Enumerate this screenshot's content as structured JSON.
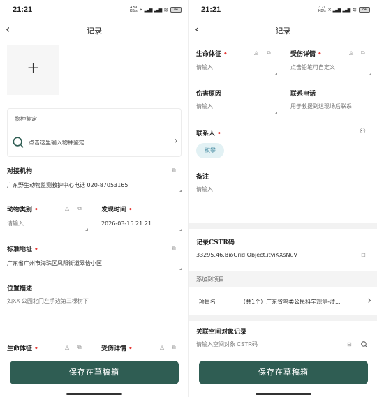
{
  "status": {
    "time": "21:21",
    "left_speed_value": "4.59",
    "right_speed_value": "3.21",
    "speed_unit": "KB/s",
    "battery": "84"
  },
  "nav": {
    "title": "记录"
  },
  "photo": {
    "plus": "+"
  },
  "species": {
    "label": "物种鉴定",
    "hint": "点击这里输入物种鉴定"
  },
  "fields": {
    "agency": {
      "label": "对接机构",
      "value": "广东野生动物监测救护中心电话 020-87053165"
    },
    "animal_type": {
      "label": "动物类别",
      "placeholder": "请输入"
    },
    "found_time": {
      "label": "发现时间",
      "value": "2026-03-15 21:21"
    },
    "address": {
      "label": "标准地址",
      "value": "广东省广州市海珠区凤阳街道翠怡小区"
    },
    "location_desc": {
      "label": "位置描述",
      "placeholder": "如XX 公园北门左手边第三棵树下"
    },
    "vital_signs": {
      "label": "生命体征",
      "placeholder": "请输入"
    },
    "injury": {
      "label": "受伤详情",
      "placeholder": "点击铅笔可自定义"
    },
    "injury_cause": {
      "label": "伤害原因",
      "placeholder": "请输入"
    },
    "contact_phone": {
      "label": "联系电话",
      "placeholder": "用于救援到达现场后联系"
    },
    "contact_person": {
      "label": "联系人",
      "chip": "权攀"
    },
    "remarks": {
      "label": "备注",
      "placeholder": "请输入"
    },
    "cstr": {
      "label": "记录CSTR码",
      "value": "33295.46.BioGrid.Object.itviKXsNuV"
    },
    "project": {
      "bar": "添加到项目",
      "label": "项目名",
      "value": "（共1个）广东省鸟类公民科学观测-涉..."
    },
    "spatial": {
      "label": "关联空间对象记录",
      "placeholder": "请输入空间对象 CSTR码"
    }
  },
  "save_button": "保存在草稿箱",
  "colors": {
    "primary": "#2f5d53",
    "required": "#e53935",
    "chip_bg": "#e2f1f4",
    "chip_text": "#4c8fa5"
  }
}
